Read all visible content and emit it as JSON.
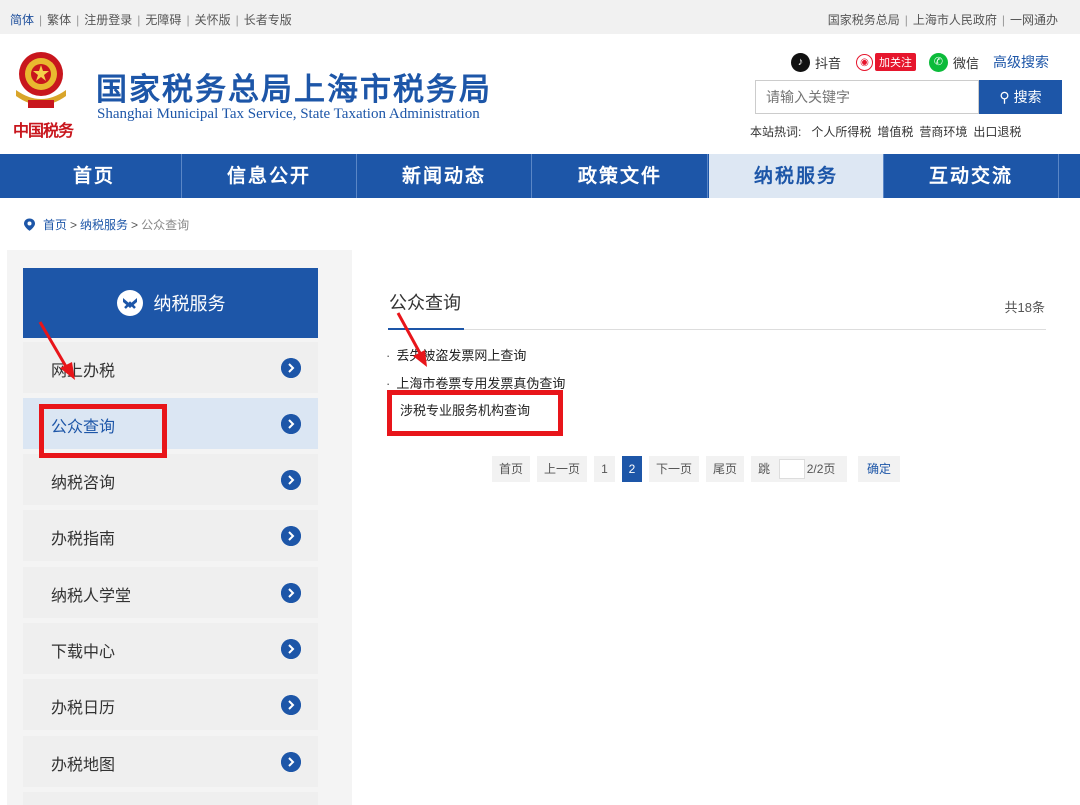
{
  "topbar": {
    "left_links": [
      "简体",
      "繁体",
      "注册登录",
      "无障碍",
      "关怀版",
      "长者专版"
    ],
    "right_links": [
      "国家税务总局",
      "上海市人民政府",
      "一网通办"
    ]
  },
  "header": {
    "title": "国家税务总局上海市税务局",
    "subtitle": "Shanghai Municipal Tax Service, State Taxation Administration",
    "logo_text": "中国税务",
    "social": {
      "tiktok": "抖音",
      "weibo": "加关注",
      "wechat": "微信"
    },
    "advanced_search": "高级搜索",
    "search": {
      "placeholder": "请输入关键字",
      "button": "搜索"
    },
    "hot": {
      "label": "本站热词:",
      "words": [
        "个人所得税",
        "增值税",
        "营商环境",
        "出口退税"
      ]
    }
  },
  "nav": {
    "items": [
      "首页",
      "信息公开",
      "新闻动态",
      "政策文件",
      "纳税服务",
      "互动交流"
    ],
    "active_index": 4
  },
  "breadcrumb": {
    "home": "首页",
    "section": "纳税服务",
    "current": "公众查询",
    "sep": ">"
  },
  "sidebar": {
    "title": "纳税服务",
    "items": [
      "网上办税",
      "公众查询",
      "纳税咨询",
      "办税指南",
      "纳税人学堂",
      "下载中心",
      "办税日历",
      "办税地图"
    ],
    "active_index": 1
  },
  "main": {
    "title": "公众查询",
    "count": "共18条",
    "list": [
      "丢失被盗发票网上查询",
      "上海市卷票专用发票真伪查询",
      "涉税专业服务机构查询"
    ],
    "list_bullet": "·"
  },
  "pager": {
    "first": "首页",
    "prev": "上一页",
    "pages": [
      "1",
      "2"
    ],
    "current": "2",
    "next": "下一页",
    "last": "尾页",
    "jump": "跳",
    "page_info": "2/2页",
    "confirm": "确定"
  },
  "colors": {
    "brand_blue": "#1d56a8",
    "annotation_red": "#e8151a"
  }
}
